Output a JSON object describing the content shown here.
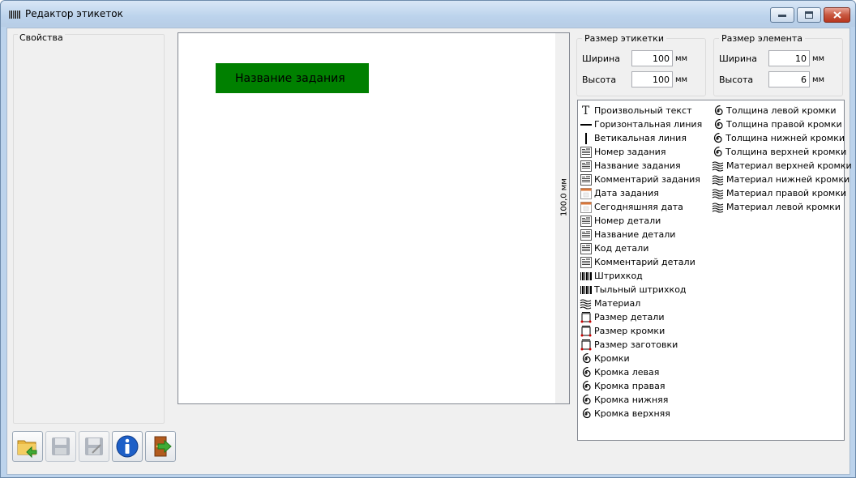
{
  "window": {
    "title": "Редактор этикеток"
  },
  "properties": {
    "label": "Свойства"
  },
  "canvas": {
    "element_text": "Название задания",
    "ruler_text": "100,0 мм",
    "element_color": "#008000"
  },
  "label_size": {
    "title": "Размер этикетки",
    "width_label": "Ширина",
    "width_value": "100",
    "height_label": "Высота",
    "height_value": "100",
    "unit": "мм"
  },
  "element_size": {
    "title": "Размер элемента",
    "width_label": "Ширина",
    "width_value": "10",
    "height_label": "Высота",
    "height_value": "6",
    "unit": "мм"
  },
  "tools_col1": [
    {
      "label": "Произвольный текст",
      "icon": "text-icon"
    },
    {
      "label": "Горизонтальная линия",
      "icon": "horizontal-line-icon"
    },
    {
      "label": "Ветикальная линия",
      "icon": "vertical-line-icon"
    },
    {
      "label": "Номер задания",
      "icon": "document-field-icon"
    },
    {
      "label": "Название задания",
      "icon": "document-field-icon"
    },
    {
      "label": "Комментарий задания",
      "icon": "document-field-icon"
    },
    {
      "label": "Дата задания",
      "icon": "calendar-icon"
    },
    {
      "label": "Сегодняшняя дата",
      "icon": "calendar-icon"
    },
    {
      "label": "Номер детали",
      "icon": "document-field-icon"
    },
    {
      "label": "Название детали",
      "icon": "document-field-icon"
    },
    {
      "label": "Код детали",
      "icon": "document-field-icon"
    },
    {
      "label": "Комментарий детали",
      "icon": "document-field-icon"
    },
    {
      "label": "Штрихкод",
      "icon": "barcode-icon"
    },
    {
      "label": "Тыльный штрихкод",
      "icon": "barcode-icon"
    },
    {
      "label": "Материал",
      "icon": "material-icon"
    },
    {
      "label": "Размер детали",
      "icon": "dimension-icon"
    },
    {
      "label": "Размер кромки",
      "icon": "dimension-icon"
    },
    {
      "label": "Размер заготовки",
      "icon": "dimension-icon"
    },
    {
      "label": "Кромки",
      "icon": "spiral-icon"
    },
    {
      "label": "Кромка левая",
      "icon": "spiral-icon"
    },
    {
      "label": "Кромка правая",
      "icon": "spiral-icon"
    },
    {
      "label": "Кромка нижняя",
      "icon": "spiral-icon"
    },
    {
      "label": "Кромка верхняя",
      "icon": "spiral-icon"
    }
  ],
  "tools_col2": [
    {
      "label": "Толщина левой кромки",
      "icon": "spiral-icon"
    },
    {
      "label": "Толщина правой кромки",
      "icon": "spiral-icon"
    },
    {
      "label": "Толщина нижней кромки",
      "icon": "spiral-icon"
    },
    {
      "label": "Толщина верхней кромки",
      "icon": "spiral-icon"
    },
    {
      "label": "Материал верхней кромки",
      "icon": "material-icon"
    },
    {
      "label": "Материал нижней кромки",
      "icon": "material-icon"
    },
    {
      "label": "Материал правой кромки",
      "icon": "material-icon"
    },
    {
      "label": "Материал левой кромки",
      "icon": "material-icon"
    }
  ],
  "toolbar": [
    {
      "name": "open-button",
      "icon": "open-folder-icon",
      "enabled": true
    },
    {
      "name": "save-button",
      "icon": "floppy-disk-icon",
      "enabled": false
    },
    {
      "name": "save-as-button",
      "icon": "floppy-save-as-icon",
      "enabled": false
    },
    {
      "name": "info-button",
      "icon": "info-icon",
      "enabled": true
    },
    {
      "name": "exit-button",
      "icon": "exit-door-icon",
      "enabled": true
    }
  ]
}
